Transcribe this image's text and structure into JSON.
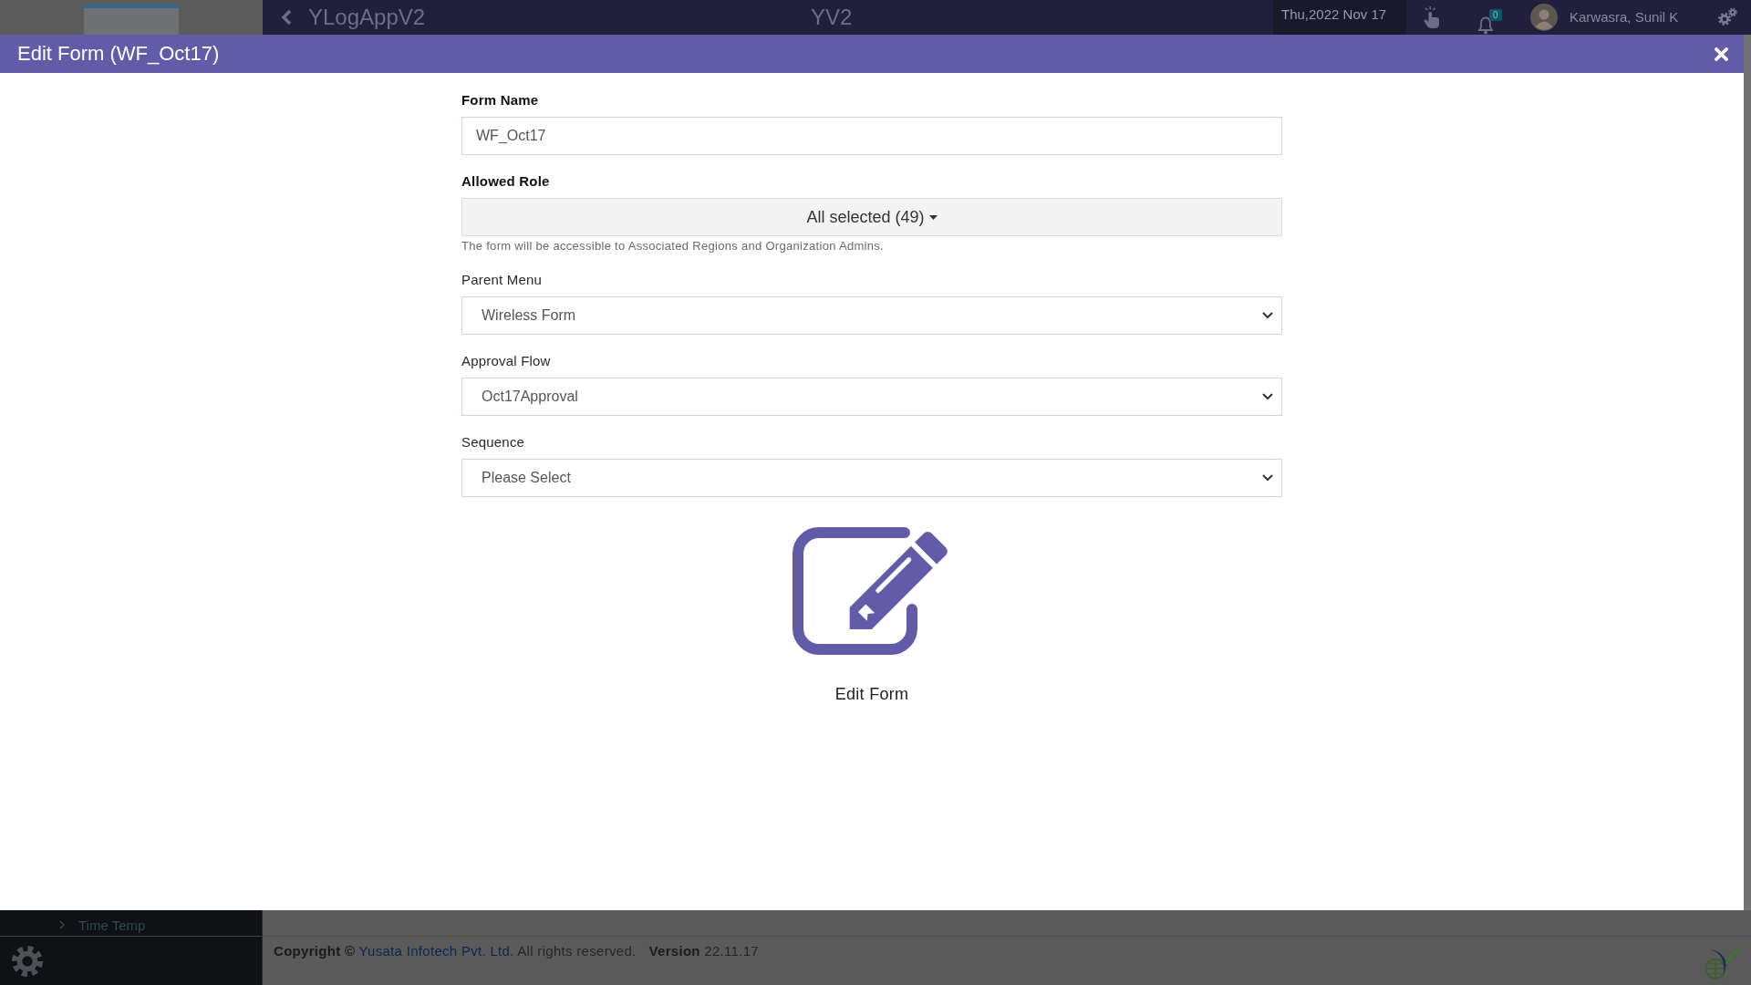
{
  "app_header": {
    "app_title": "YLogAppV2",
    "center_title": "YV2",
    "date": "Thu,2022 Nov 17",
    "notification_count": "0",
    "user_name": "Karwasra, Sunil K"
  },
  "modal": {
    "title": "Edit Form (WF_Oct17)",
    "fields": [
      {
        "kind": "text",
        "label": "Form Name",
        "bold_label": true,
        "value": "WF_Oct17"
      },
      {
        "kind": "multiselect",
        "label": "Allowed Role",
        "bold_label": true,
        "value": "All selected (49)",
        "help": "The form will be accessible to Associated Regions and Organization Admins."
      },
      {
        "kind": "select",
        "label": "Parent Menu",
        "bold_label": false,
        "value": "Wireless Form"
      },
      {
        "kind": "select",
        "label": "Approval Flow",
        "bold_label": false,
        "value": "Oct17Approval"
      },
      {
        "kind": "select",
        "label": "Sequence",
        "bold_label": false,
        "value": "Please Select"
      }
    ],
    "action": {
      "label": "Edit Form"
    }
  },
  "sidebar": {
    "items": [
      {
        "label": "Time Temp"
      }
    ]
  },
  "footer": {
    "copyright_before": "**Copyright ©** ",
    "company_link": "Yusata Infotech Pvt. Ltd.",
    "copyright_after": " All rights reserved.",
    "version": "**Version** 22.11.17"
  }
}
